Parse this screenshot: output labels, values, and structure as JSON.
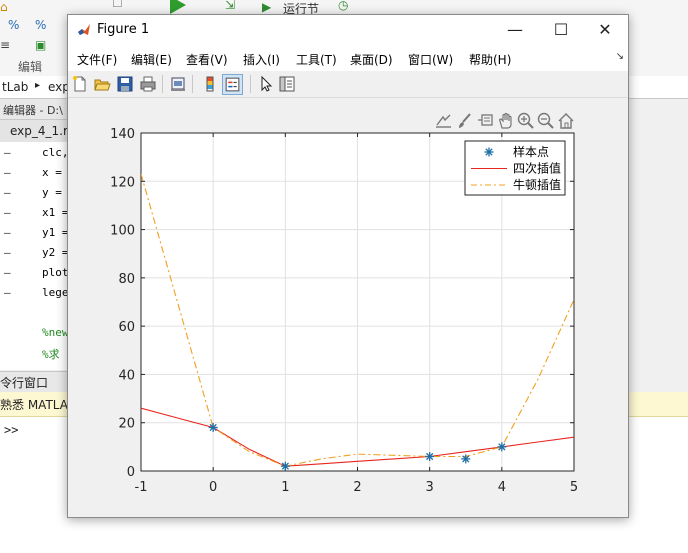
{
  "background": {
    "toolstrip": {
      "run_section_label": "运行节",
      "edit_group_label": "编辑"
    },
    "address": {
      "segment1": "tLab",
      "separator": "▸",
      "segment2": "exp"
    },
    "editor": {
      "title": "编辑器 - D:\\",
      "tab_label": "exp_4_1.r",
      "code_lines": [
        "clc,",
        "x =",
        "y =",
        "x1 =",
        "y1 =",
        "y2 =",
        "plot",
        "lege",
        "",
        "%new",
        "%求"
      ]
    },
    "command_window": {
      "title": "令行窗口",
      "banner_text": "熟悉 MATLA",
      "prompt": ">>"
    }
  },
  "figure": {
    "title": "Figure 1",
    "window_controls": {
      "minimize": "—",
      "maximize": "☐",
      "close": "✕"
    },
    "menu": [
      "文件(F)",
      "编辑(E)",
      "查看(V)",
      "插入(I)",
      "工具(T)",
      "桌面(D)",
      "窗口(W)",
      "帮助(H)"
    ],
    "menu_overflow": "↘",
    "toolbar_icons": [
      "new-file-icon",
      "open-folder-icon",
      "save-icon",
      "print-icon",
      "print-preview-icon",
      "colorbar-icon",
      "legend-icon",
      "pointer-icon",
      "property-inspector-icon"
    ],
    "axes_toolbar_icons": [
      "export-icon",
      "brush-icon",
      "data-tips-icon",
      "pan-icon",
      "zoom-in-icon",
      "zoom-out-icon",
      "home-icon"
    ]
  },
  "chart_data": {
    "type": "line",
    "title": "",
    "xlabel": "",
    "ylabel": "",
    "xlim": [
      -1,
      5
    ],
    "ylim": [
      0,
      140
    ],
    "xticks": [
      -1,
      0,
      1,
      2,
      3,
      4,
      5
    ],
    "yticks": [
      0,
      20,
      40,
      60,
      80,
      100,
      120,
      140
    ],
    "grid": true,
    "legend_position": "top-right",
    "series": [
      {
        "name": "样本点",
        "style": "markers",
        "marker": "asterisk",
        "color": "#1f6fa5",
        "x": [
          0,
          1,
          3,
          3.5,
          4
        ],
        "y": [
          18,
          2,
          6,
          5,
          10
        ]
      },
      {
        "name": "四次插值",
        "style": "solid",
        "color": "#e8251f",
        "x": [
          -1,
          -0.5,
          0,
          0.5,
          1,
          1.5,
          2,
          2.5,
          3,
          3.5,
          4,
          4.5,
          5
        ],
        "y": [
          26,
          22,
          18,
          9,
          2,
          3,
          4,
          5,
          6,
          8,
          10,
          12,
          14
        ]
      },
      {
        "name": "牛顿插值",
        "style": "dash-dot",
        "color": "#f0a020",
        "x": [
          -1,
          0,
          0.5,
          1,
          1.5,
          2,
          2.5,
          3,
          3.5,
          4,
          4.5,
          5
        ],
        "y": [
          123,
          18,
          8,
          2,
          5,
          7,
          6.5,
          6,
          6,
          10,
          38,
          71
        ]
      }
    ]
  }
}
